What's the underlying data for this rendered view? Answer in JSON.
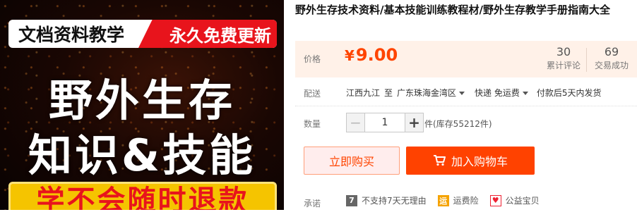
{
  "promo": {
    "banner_left": "文档资料教学",
    "banner_right": "永久免费更新",
    "line1": "野外生存",
    "line2": "知识&技能",
    "bottom": "学不会随时退款"
  },
  "product": {
    "title": "野外生存技术资料/基本技能训练教程材/野外生存教学手册指南大全"
  },
  "price": {
    "label": "价格",
    "currency": "¥",
    "amount": "9.00",
    "reviews_count": "30",
    "reviews_label": "累计评论",
    "sales_count": "69",
    "sales_label": "交易成功"
  },
  "shipping": {
    "label": "配送",
    "from": "江西九江",
    "to_prefix": "至",
    "destination": "广东珠海金湾区",
    "method": "快递 免运费",
    "dispatch": "付款后5天内发货"
  },
  "quantity": {
    "label": "数量",
    "value": "1",
    "minus": "−",
    "plus": "+",
    "stock": "件(库存55212件)"
  },
  "actions": {
    "buy_now": "立即购买",
    "add_cart": "加入购物车"
  },
  "promise": {
    "label": "承诺",
    "items": [
      {
        "icon": "seven-day-return-icon",
        "glyph": "7",
        "text": "不支持7天无理由"
      },
      {
        "icon": "freight-insurance-icon",
        "glyph": "运",
        "text": "运费险"
      },
      {
        "icon": "charity-icon",
        "glyph": "♥",
        "text": "公益宝贝"
      }
    ]
  },
  "colors": {
    "accent": "#ff4400",
    "price_bg": "#fff1e8",
    "buy_now_bg": "#ffeded",
    "add_cart_bg": "#ff4200"
  }
}
